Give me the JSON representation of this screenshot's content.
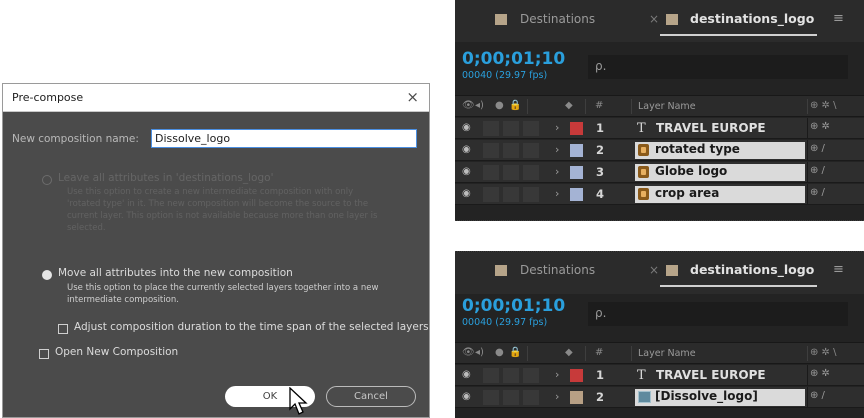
{
  "dialog": {
    "title": "Pre-compose",
    "close_glyph": "×",
    "name_label": "New composition name:",
    "name_value": "Dissolve_logo",
    "option1_label": "Leave all attributes in 'destinations_logo'",
    "option1_desc": "Use this option to create a new intermediate composition with only 'rotated type' in it. The new composition will become the source to the current layer. This option is not available because more than one layer is selected.",
    "option2_label": "Move all attributes into the new composition",
    "option2_desc": "Use this option to place the currently selected layers together into a new intermediate composition.",
    "adjust_label": "Adjust composition duration to the time span of the selected layers",
    "open_label": "Open New Composition",
    "ok_label": "OK",
    "cancel_label": "Cancel"
  },
  "timeline_top": {
    "tab1": "Destinations",
    "tab_close": "×",
    "tab2": "destinations_logo",
    "menu_glyph": "≡",
    "timecode": "0;00;01;10",
    "frames": "00040 (29.97 fps)",
    "search_glyph": "ρ.",
    "col_hash": "#",
    "col_name": "Layer Name",
    "layers": [
      {
        "num": "1",
        "icon": "T",
        "name": "TRAVEL EUROPE",
        "color": "#c73a3a",
        "selected": false
      },
      {
        "num": "2",
        "icon": "",
        "name": "rotated type",
        "color": "#a4b3d4",
        "selected": true
      },
      {
        "num": "3",
        "icon": "",
        "name": "Globe logo",
        "color": "#a4b3d4",
        "selected": true
      },
      {
        "num": "4",
        "icon": "",
        "name": "crop area",
        "color": "#a4b3d4",
        "selected": true
      }
    ]
  },
  "timeline_bottom": {
    "tab1": "Destinations",
    "tab_close": "×",
    "tab2": "destinations_logo",
    "menu_glyph": "≡",
    "timecode": "0;00;01;10",
    "frames": "00040 (29.97 fps)",
    "search_glyph": "ρ.",
    "col_hash": "#",
    "col_name": "Layer Name",
    "layers": [
      {
        "num": "1",
        "icon": "T",
        "name": "TRAVEL EUROPE",
        "color": "#c73a3a",
        "selected": false
      },
      {
        "num": "2",
        "icon": "",
        "name": "[Dissolve_logo]",
        "color": "#b8a085",
        "selected": true
      }
    ]
  }
}
